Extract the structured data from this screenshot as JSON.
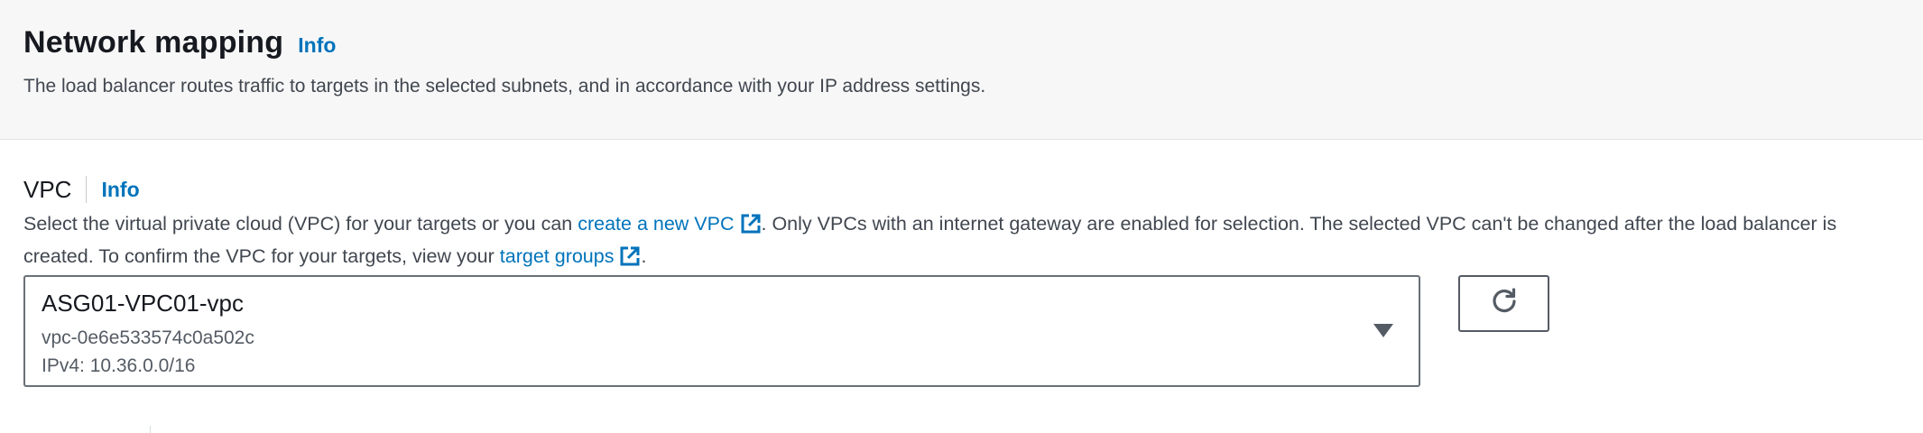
{
  "section": {
    "title": "Network mapping",
    "info_label": "Info",
    "description": "The load balancer routes traffic to targets in the selected subnets, and in accordance with your IP address settings."
  },
  "vpc": {
    "label": "VPC",
    "info_label": "Info",
    "description_part1": "Select the virtual private cloud (VPC) for your targets or you can ",
    "create_link": "create a new VPC",
    "description_part2": ". Only VPCs with an internet gateway are enabled for selection. The selected VPC can't be changed after the load balancer is created. To confirm the VPC for your targets, view your ",
    "target_groups_link": "target groups",
    "description_part3": ".",
    "selected": {
      "name": "ASG01-VPC01-vpc",
      "id": "vpc-0e6e533574c0a502c",
      "cidr": "IPv4: 10.36.0.0/16"
    },
    "refresh_icon": "refresh-icon",
    "dropdown_icon": "caret-down-icon",
    "external_icon": "external-link-icon"
  },
  "colors": {
    "link": "#0073bb",
    "header_bg": "#f7f7f7",
    "text": "#16191f",
    "muted_text": "#545b64"
  }
}
